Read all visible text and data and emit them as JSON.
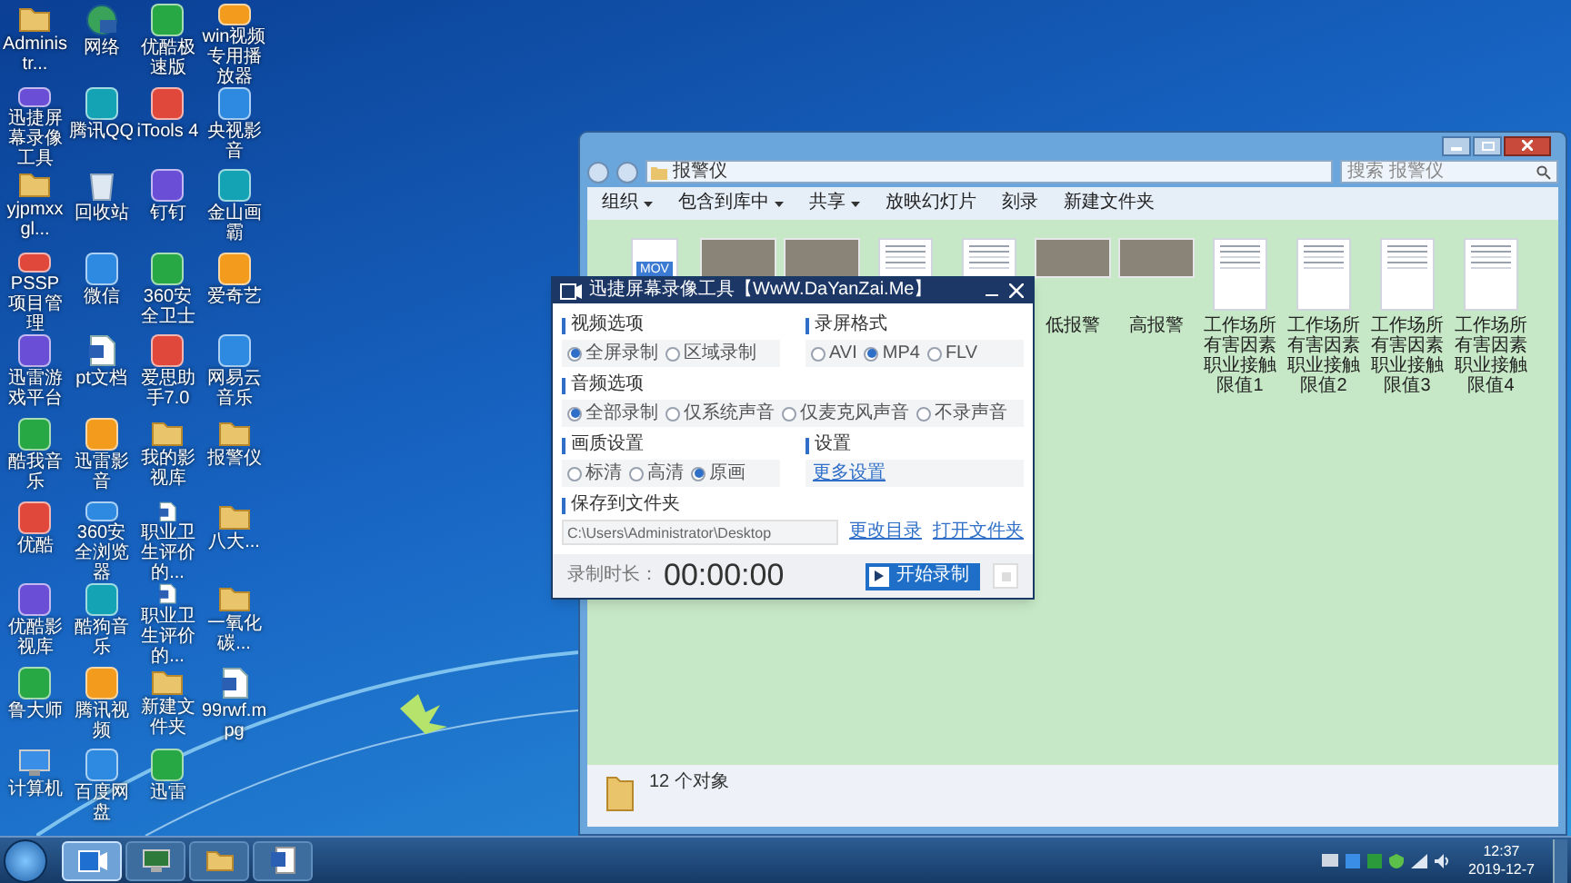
{
  "desktop_icons": [
    {
      "label": "Administr...",
      "kind": "folder"
    },
    {
      "label": "网络",
      "kind": "network"
    },
    {
      "label": "优酷极速版",
      "kind": "app"
    },
    {
      "label": "win视频专用播放器",
      "kind": "app"
    },
    {
      "label": "迅捷屏幕录像工具",
      "kind": "app"
    },
    {
      "label": "腾讯QQ",
      "kind": "app"
    },
    {
      "label": "iTools 4",
      "kind": "app"
    },
    {
      "label": "央视影音",
      "kind": "app"
    },
    {
      "label": "yjpmxxgl...",
      "kind": "folder"
    },
    {
      "label": "回收站",
      "kind": "recycle"
    },
    {
      "label": "钉钉",
      "kind": "app"
    },
    {
      "label": "金山画霸",
      "kind": "app"
    },
    {
      "label": "PSSP项目管理",
      "kind": "app"
    },
    {
      "label": "微信",
      "kind": "app"
    },
    {
      "label": "360安全卫士",
      "kind": "app"
    },
    {
      "label": "爱奇艺",
      "kind": "app"
    },
    {
      "label": "迅雷游戏平台",
      "kind": "app"
    },
    {
      "label": "pt文档",
      "kind": "doc"
    },
    {
      "label": "爱思助手7.0",
      "kind": "app"
    },
    {
      "label": "网易云音乐",
      "kind": "app"
    },
    {
      "label": "酷我音乐",
      "kind": "app"
    },
    {
      "label": "迅雷影音",
      "kind": "app"
    },
    {
      "label": "我的影视库",
      "kind": "folder"
    },
    {
      "label": "报警仪",
      "kind": "folder"
    },
    {
      "label": "优酷",
      "kind": "app"
    },
    {
      "label": "360安全浏览器",
      "kind": "app"
    },
    {
      "label": "职业卫生评价的...",
      "kind": "doc"
    },
    {
      "label": "八大...",
      "kind": "folder"
    },
    {
      "label": "优酷影视库",
      "kind": "app"
    },
    {
      "label": "酷狗音乐",
      "kind": "app"
    },
    {
      "label": "职业卫生评价的...",
      "kind": "doc"
    },
    {
      "label": "一氧化碳...",
      "kind": "folder"
    },
    {
      "label": "鲁大师",
      "kind": "app"
    },
    {
      "label": "腾讯视频",
      "kind": "app"
    },
    {
      "label": "新建文件夹",
      "kind": "folder"
    },
    {
      "label": "99rwf.mpg",
      "kind": "doc"
    },
    {
      "label": "计算机",
      "kind": "computer"
    },
    {
      "label": "百度网盘",
      "kind": "app"
    },
    {
      "label": "迅雷",
      "kind": "app"
    }
  ],
  "explorer": {
    "address": "报警仪",
    "search_placeholder": "搜索 报警仪",
    "toolbar": [
      {
        "label": "组织",
        "menu": true
      },
      {
        "label": "包含到库中",
        "menu": true
      },
      {
        "label": "共享",
        "menu": true
      },
      {
        "label": "放映幻灯片",
        "menu": false
      },
      {
        "label": "刻录",
        "menu": false
      },
      {
        "label": "新建文件夹",
        "menu": false
      }
    ],
    "files": [
      {
        "kind": "video",
        "badge": "MOV"
      },
      {
        "kind": "photo"
      },
      {
        "kind": "photo"
      },
      {
        "kind": "document"
      },
      {
        "kind": "document"
      },
      {
        "kind": "photo",
        "label": "低报警"
      },
      {
        "kind": "photo",
        "label": "高报警"
      },
      {
        "kind": "document",
        "label": "工作场所有害因素职业接触限值1"
      },
      {
        "kind": "document",
        "label": "工作场所有害因素职业接触限值2"
      },
      {
        "kind": "document",
        "label": "工作场所有害因素职业接触限值3"
      },
      {
        "kind": "document",
        "label": "工作场所有害因素职业接触限值4"
      }
    ],
    "status": "12 个对象"
  },
  "recorder": {
    "title": "迅捷屏幕录像工具【WwW.DaYanZai.Me】",
    "rows": [
      [
        {
          "kind": "radio",
          "heading": "视频选项",
          "options": [
            {
              "label": "全屏录制",
              "selected": true
            },
            {
              "label": "区域录制",
              "selected": false
            }
          ]
        },
        {
          "kind": "radio",
          "heading": "录屏格式",
          "options": [
            {
              "label": "AVI",
              "selected": false
            },
            {
              "label": "MP4",
              "selected": true
            },
            {
              "label": "FLV",
              "selected": false
            }
          ]
        }
      ],
      [
        {
          "kind": "radio",
          "heading": "音频选项",
          "options": [
            {
              "label": "全部录制",
              "selected": true
            },
            {
              "label": "仅系统声音",
              "selected": false
            },
            {
              "label": "仅麦克风声音",
              "selected": false
            },
            {
              "label": "不录声音",
              "selected": false
            }
          ]
        }
      ],
      [
        {
          "kind": "radio",
          "heading": "画质设置",
          "options": [
            {
              "label": "标清",
              "selected": false
            },
            {
              "label": "高清",
              "selected": false
            },
            {
              "label": "原画",
              "selected": true
            }
          ]
        },
        {
          "kind": "link",
          "heading": "设置",
          "link": "更多设置"
        }
      ]
    ],
    "save": {
      "heading": "保存到文件夹",
      "path": "C:\\Users\\Administrator\\Desktop",
      "links": [
        "更改目录",
        "打开文件夹"
      ]
    },
    "duration_label": "录制时长：",
    "duration": "00:00:00",
    "start_button": "开始录制"
  },
  "taskbar": {
    "apps": [
      {
        "kind": "recorder",
        "selected": true
      },
      {
        "kind": "computer",
        "selected": false
      },
      {
        "kind": "folder",
        "selected": false
      },
      {
        "kind": "word",
        "selected": false
      }
    ],
    "time": "12:37",
    "date": "2019-12-7"
  }
}
